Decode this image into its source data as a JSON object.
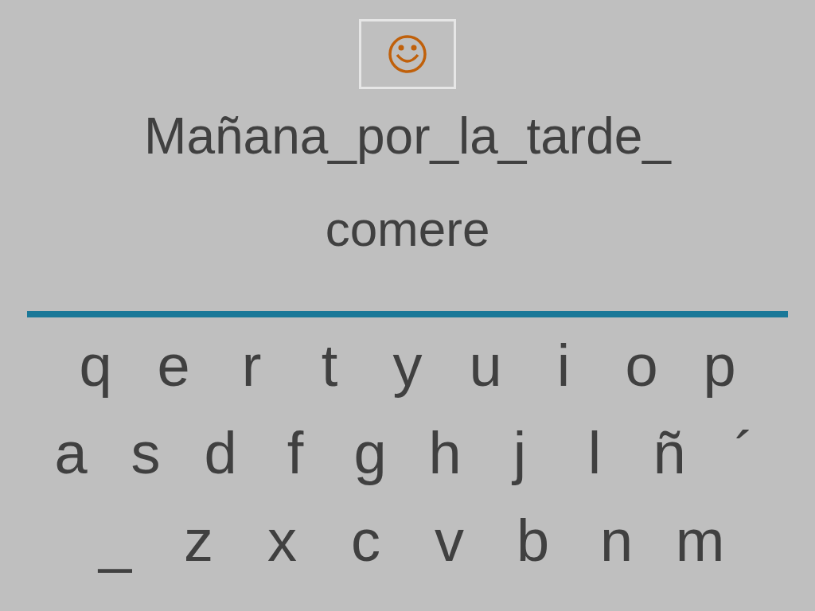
{
  "sentence": "Mañana_por_la_tarde_",
  "answer": "comere",
  "keyboard": [
    [
      "q",
      "e",
      "r",
      "t",
      "y",
      "u",
      "i",
      "o",
      "p"
    ],
    [
      "a",
      "s",
      "d",
      "f",
      "g",
      "h",
      "j",
      "l",
      "ñ",
      "´"
    ],
    [
      "_",
      "z",
      "x",
      "c",
      "v",
      "b",
      "n",
      "m"
    ]
  ]
}
